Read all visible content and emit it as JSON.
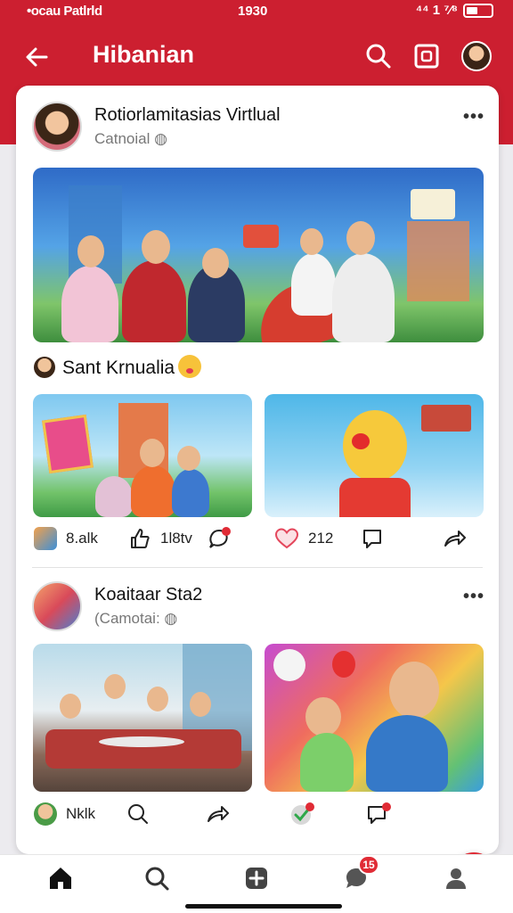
{
  "status_bar": {
    "carrier": "•ocau Patlrld",
    "time": "1930",
    "right": "⁴⁴ 1 ⁷⁄⁸"
  },
  "navbar": {
    "title": "Hibanian"
  },
  "post1": {
    "author": "Rotiorlamitasias Virtlual",
    "subtitle": "Catnoial",
    "caption": "Sant Krnualia",
    "actions": {
      "tag": "8.alk",
      "likes": "1l8tv",
      "hearts": "212"
    }
  },
  "post2": {
    "author": "Koaitaar Sta2",
    "subtitle": "(Camotai:",
    "actions": {
      "tag": "Nklk"
    }
  },
  "bottom_nav": {
    "messages_badge": "15"
  },
  "colors": {
    "brand": "#cc1f30",
    "accent": "#e02b35",
    "card": "#ffffff"
  },
  "icons": [
    "back-arrow-icon",
    "search-icon",
    "share-box-icon",
    "avatar",
    "more-icon",
    "like-icon",
    "comment-icon",
    "heart-icon",
    "share-icon",
    "home-icon",
    "plus-icon",
    "chat-icon",
    "profile-icon"
  ]
}
